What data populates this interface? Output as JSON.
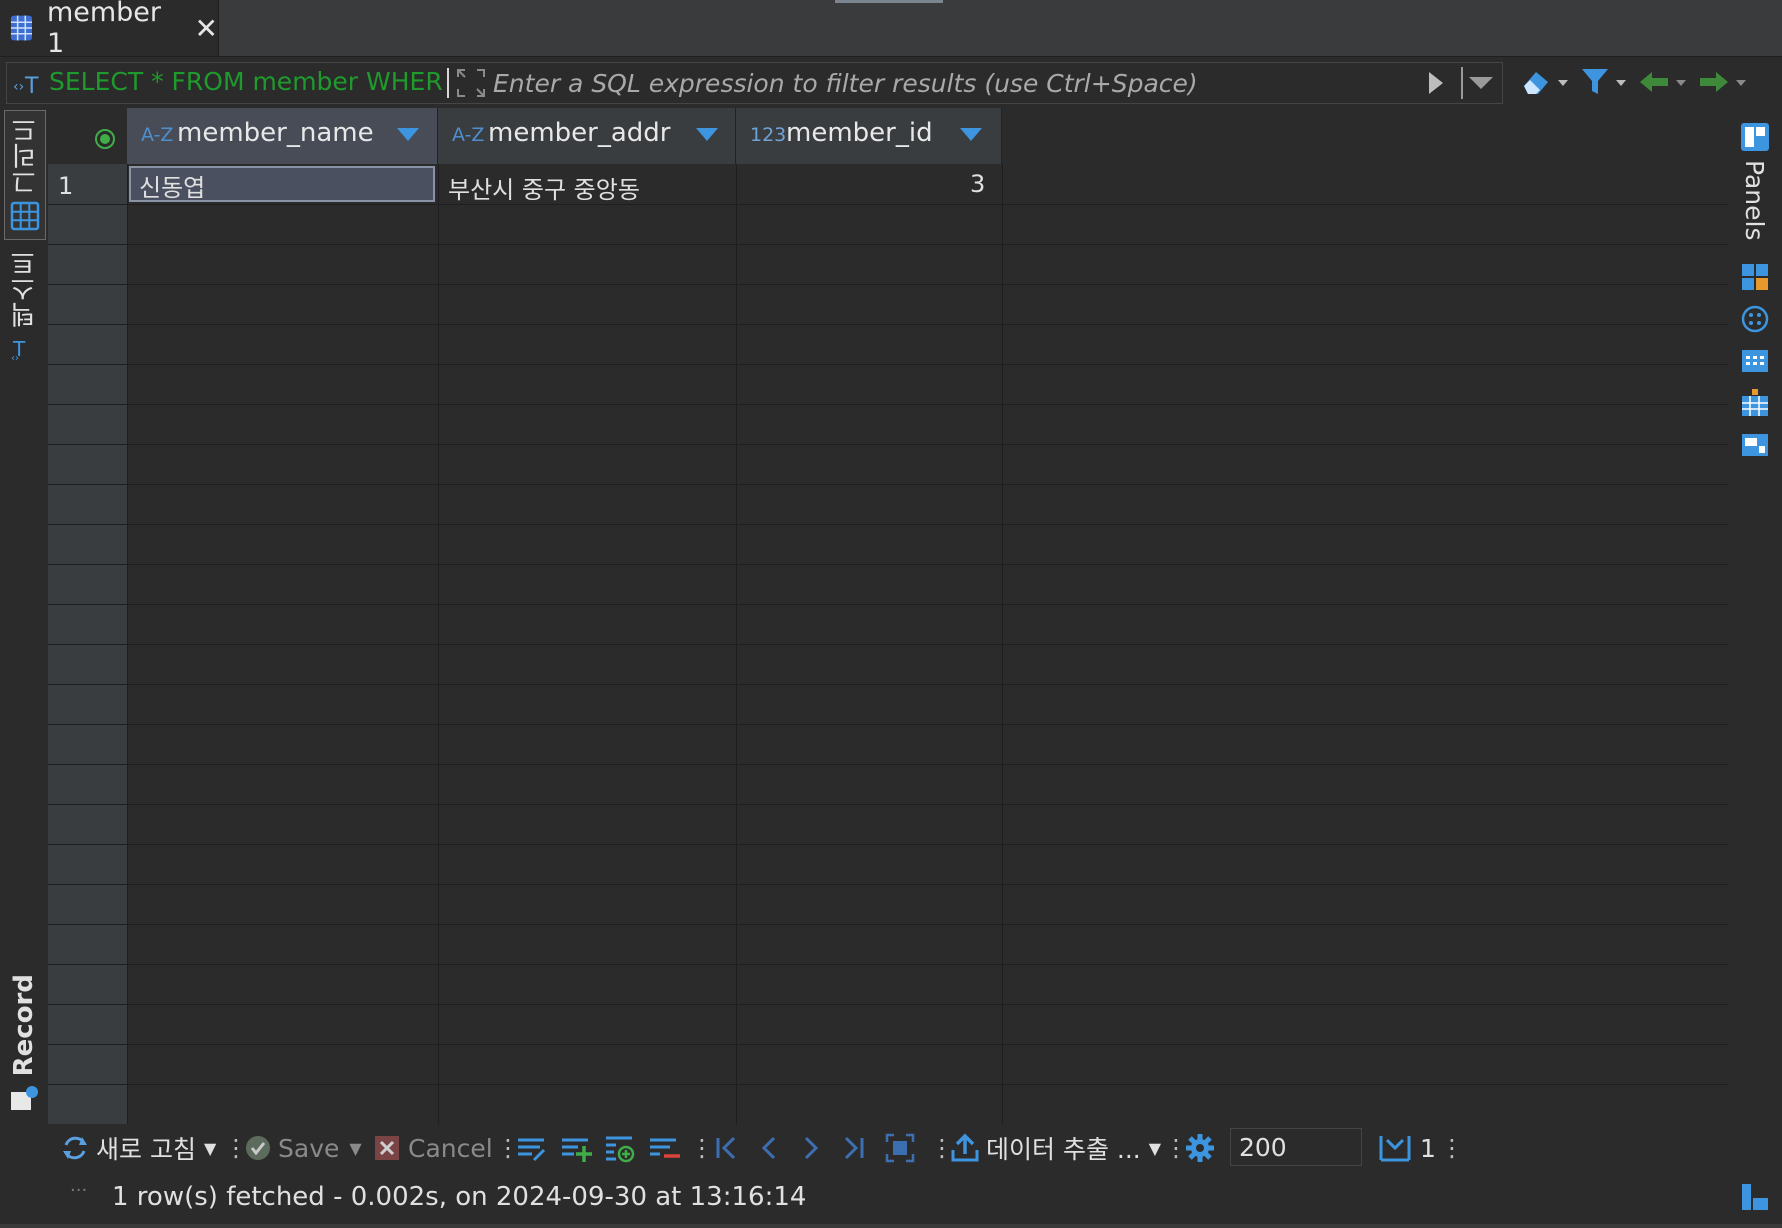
{
  "tab": {
    "title": "member 1"
  },
  "filter": {
    "sql": "SELECT * FROM member WHER",
    "placeholder": "Enter a SQL expression to filter results (use Ctrl+Space)"
  },
  "left_tabs": {
    "grid": "그리드",
    "text": "텍스트",
    "record": "Record"
  },
  "right_panel": {
    "label": "Panels"
  },
  "columns": [
    {
      "type": "A-Z",
      "name": "member_name"
    },
    {
      "type": "A-Z",
      "name": "member_addr"
    },
    {
      "type": "123",
      "name": "member_id"
    }
  ],
  "rows": [
    {
      "num": "1",
      "member_name": "신동엽",
      "member_addr": "부산시 중구 중앙동",
      "member_id": "3"
    }
  ],
  "bottom": {
    "refresh": "새로 고침",
    "save": "Save",
    "cancel": "Cancel",
    "export": "데이터 추출 ...",
    "fetch_size": "200",
    "row_count": "1"
  },
  "status": "1 row(s) fetched - 0.002s, on 2024-09-30 at 13:16:14",
  "colors": {
    "accent_blue": "#3d95e0",
    "sql_green": "#1f9a2c",
    "background": "#2b2b2b",
    "header": "#3a3d40",
    "selected_cell": "#4a5060"
  }
}
